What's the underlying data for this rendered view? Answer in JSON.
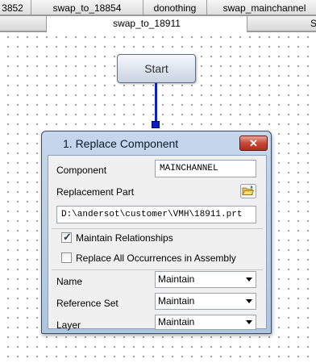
{
  "tabs_row1": [
    "3852",
    "swap_to_18854",
    "donothing",
    "swap_mainchannel"
  ],
  "tabs_row2": [
    "",
    "swap_to_18911",
    "S"
  ],
  "start_node": {
    "label": "Start"
  },
  "dialog": {
    "title": "1. Replace Component",
    "close_symbol": "✕",
    "component_label": "Component",
    "component_value": "MAINCHANNEL",
    "replacement_part_label": "Replacement Part",
    "replacement_path": "D:\\andersot\\customer\\VMH\\18911.prt",
    "maintain_relationships_label": "Maintain Relationships",
    "maintain_relationships_checked": true,
    "replace_all_label": "Replace All Occurrences in Assembly",
    "replace_all_checked": false,
    "name_label": "Name",
    "name_value": "Maintain",
    "reference_set_label": "Reference Set",
    "reference_set_value": "Maintain",
    "layer_label": "Layer",
    "layer_value": "Maintain",
    "check_mark": "✓"
  },
  "icons": {
    "folder": "folder-open-icon",
    "close": "close-icon",
    "dropdown": "chevron-down-icon"
  },
  "colors": {
    "connector": "#0a1fc8",
    "dialog_title_bar": "#bcd0e6",
    "close_button": "#c7483a"
  }
}
